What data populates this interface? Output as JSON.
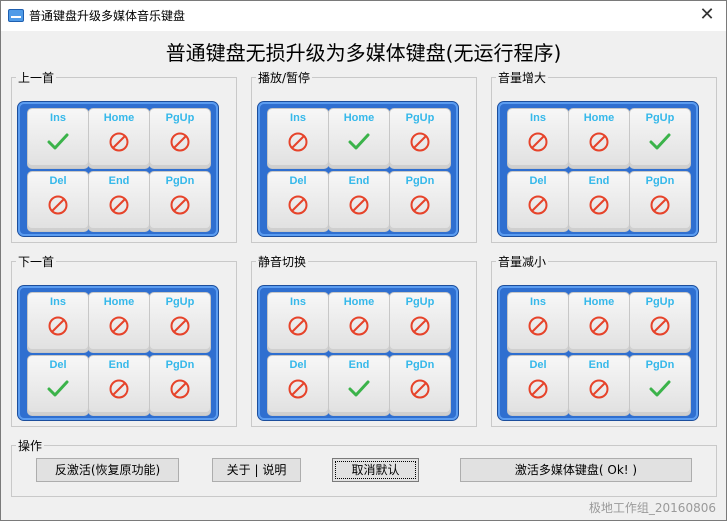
{
  "window": {
    "title": "普通键盘升级多媒体音乐键盘",
    "close_glyph": "✕"
  },
  "heading": "普通键盘无损升级为多媒体键盘(无运行程序)",
  "groups": [
    {
      "label": "上一首",
      "keys": [
        {
          "label": "Ins",
          "state": "check"
        },
        {
          "label": "Home",
          "state": "no"
        },
        {
          "label": "PgUp",
          "state": "no"
        },
        {
          "label": "Del",
          "state": "no"
        },
        {
          "label": "End",
          "state": "no"
        },
        {
          "label": "PgDn",
          "state": "no"
        }
      ]
    },
    {
      "label": "播放/暂停",
      "keys": [
        {
          "label": "Ins",
          "state": "no"
        },
        {
          "label": "Home",
          "state": "check"
        },
        {
          "label": "PgUp",
          "state": "no"
        },
        {
          "label": "Del",
          "state": "no"
        },
        {
          "label": "End",
          "state": "no"
        },
        {
          "label": "PgDn",
          "state": "no"
        }
      ]
    },
    {
      "label": "音量增大",
      "keys": [
        {
          "label": "Ins",
          "state": "no"
        },
        {
          "label": "Home",
          "state": "no"
        },
        {
          "label": "PgUp",
          "state": "check"
        },
        {
          "label": "Del",
          "state": "no"
        },
        {
          "label": "End",
          "state": "no"
        },
        {
          "label": "PgDn",
          "state": "no"
        }
      ]
    },
    {
      "label": "下一首",
      "keys": [
        {
          "label": "Ins",
          "state": "no"
        },
        {
          "label": "Home",
          "state": "no"
        },
        {
          "label": "PgUp",
          "state": "no"
        },
        {
          "label": "Del",
          "state": "check"
        },
        {
          "label": "End",
          "state": "no"
        },
        {
          "label": "PgDn",
          "state": "no"
        }
      ]
    },
    {
      "label": "静音切换",
      "keys": [
        {
          "label": "Ins",
          "state": "no"
        },
        {
          "label": "Home",
          "state": "no"
        },
        {
          "label": "PgUp",
          "state": "no"
        },
        {
          "label": "Del",
          "state": "no"
        },
        {
          "label": "End",
          "state": "check"
        },
        {
          "label": "PgDn",
          "state": "no"
        }
      ]
    },
    {
      "label": "音量减小",
      "keys": [
        {
          "label": "Ins",
          "state": "no"
        },
        {
          "label": "Home",
          "state": "no"
        },
        {
          "label": "PgUp",
          "state": "no"
        },
        {
          "label": "Del",
          "state": "no"
        },
        {
          "label": "End",
          "state": "no"
        },
        {
          "label": "PgDn",
          "state": "check"
        }
      ]
    }
  ],
  "actions": {
    "label": "操作",
    "restore_label": "反激活(恢复原功能)",
    "about_label": "关于 | 说明",
    "cancel_default_label": "取消默认",
    "activate_label": "激活多媒体键盘( Ok! )"
  },
  "footer": "极地工作组_20160806",
  "colors": {
    "keyboard_bg": "#2f6fd0",
    "key_label": "#35b8ea",
    "check": "#3bb34a",
    "prohibit": "#e6432a"
  }
}
